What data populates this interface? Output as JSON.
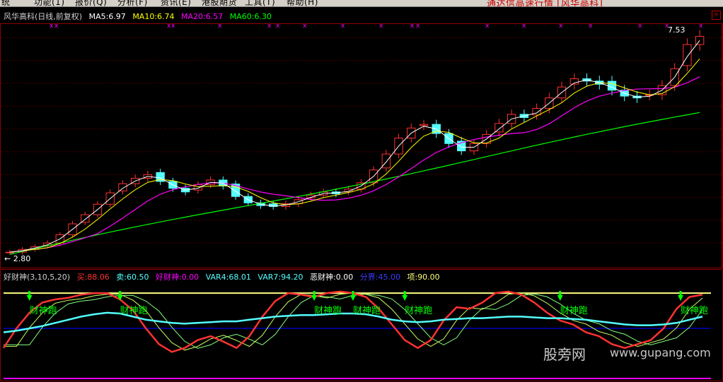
{
  "menubar": {
    "items": [
      "统",
      "功能(1)",
      "报价(Q)",
      "分析(F)",
      "资讯(E)",
      "港股期货",
      "工具(T)",
      "帮助(H)"
    ],
    "app_title": "通达信高速行情 [风华高科]"
  },
  "price_panel": {
    "stock_name": "风华高科(日线,前复权)",
    "ma5": "MA5:6.97",
    "ma10": "MA10:6.74",
    "ma20": "MA20:6.57",
    "ma60": "MA60:6.30",
    "high_marker": "7.53",
    "low_marker": "← 2.80"
  },
  "osc_panel": {
    "title": "好财神(3,10,5,20)",
    "buy": "买:88.06",
    "sell": "卖:60.50",
    "haocaishen": "好财神:0.00",
    "var4": "VAR4:68.01",
    "var7": "VAR7:94.20",
    "ecaishen": "恶财神:0.00",
    "boundary": "分界:45.00",
    "top": "项:90.00",
    "signal_label": "财神跑",
    "watermark_cn": "股旁网",
    "watermark_url": "www.gupang.com"
  },
  "colors": {
    "bg": "#000000",
    "up": "#ff3232",
    "down": "#54ffff",
    "ma5": "#ffffff",
    "ma10": "#ffff00",
    "ma20": "#ff00ff",
    "ma60": "#00ff00",
    "grid": "#8b0000",
    "sell": "#54ffff",
    "signal": "#00ff00",
    "top_line": "#ffff80",
    "boundary_line": "#0000ff"
  },
  "chart_data": [
    {
      "type": "candlestick",
      "title": "风华高科(日线,前复权)",
      "ylim": [
        2.6,
        7.8
      ],
      "series": [
        {
          "name": "close",
          "values": [
            2.8,
            2.86,
            2.92,
            3.0,
            3.18,
            3.42,
            3.62,
            3.85,
            4.1,
            4.3,
            4.42,
            4.5,
            4.35,
            4.2,
            4.12,
            4.28,
            4.38,
            4.25,
            4.02,
            3.88,
            3.82,
            3.8,
            3.86,
            3.95,
            4.05,
            4.12,
            4.08,
            4.18,
            4.32,
            4.6,
            4.95,
            5.3,
            5.52,
            5.6,
            5.4,
            5.18,
            5.02,
            5.18,
            5.38,
            5.62,
            5.82,
            5.75,
            5.95,
            6.18,
            6.42,
            6.6,
            6.55,
            6.48,
            6.35,
            6.22,
            6.18,
            6.25,
            6.45,
            6.82,
            7.35,
            7.53
          ]
        },
        {
          "name": "MA5",
          "values": [
            6.97
          ]
        },
        {
          "name": "MA10",
          "values": [
            6.74
          ]
        },
        {
          "name": "MA20",
          "values": [
            6.57
          ]
        },
        {
          "name": "MA60",
          "values": [
            6.3
          ]
        }
      ]
    },
    {
      "type": "line",
      "title": "好财神(3,10,5,20)",
      "ylim": [
        0,
        100
      ],
      "series": [
        {
          "name": "买",
          "values": [
            20,
            45,
            65,
            78,
            82,
            84,
            88,
            90,
            90,
            82,
            68,
            45,
            25,
            15,
            20,
            30,
            35,
            28,
            20,
            35,
            60,
            80,
            90,
            88,
            85,
            90,
            92,
            90,
            85,
            70,
            50,
            30,
            20,
            30,
            55,
            72,
            70,
            78,
            90,
            92,
            88,
            78,
            65,
            55,
            50,
            40,
            35,
            25,
            20,
            25,
            30,
            45,
            70,
            85,
            88
          ]
        },
        {
          "name": "卖",
          "values": [
            40,
            42,
            45,
            48,
            52,
            56,
            60,
            63,
            65,
            64,
            60,
            56,
            54,
            52,
            51,
            52,
            53,
            54,
            54,
            56,
            58,
            60,
            61,
            62,
            62,
            63,
            64,
            64,
            63,
            60,
            56,
            54,
            53,
            54,
            56,
            57,
            58,
            58,
            59,
            60,
            60,
            59,
            58,
            58,
            57,
            56,
            54,
            52,
            50,
            49,
            49,
            50,
            52,
            56,
            60
          ]
        },
        {
          "name": "分界",
          "values": [
            45
          ]
        },
        {
          "name": "项",
          "values": [
            90
          ]
        }
      ],
      "signals": [
        2,
        9,
        24,
        27,
        31,
        43,
        58
      ]
    }
  ]
}
